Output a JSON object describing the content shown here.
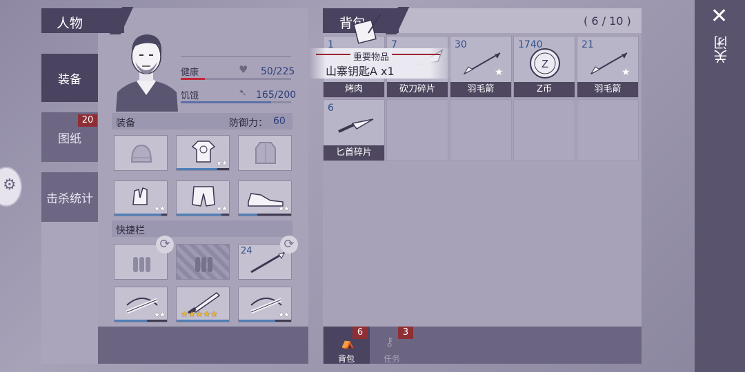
{
  "character": {
    "header": "人物",
    "health_label": "健康",
    "health_value": "50/225",
    "health_fraction": 0.22,
    "hunger_label": "饥饿",
    "hunger_value": "165/200",
    "hunger_fraction": 0.82,
    "equip_label": "装备",
    "defense_label": "防御力：",
    "defense_value": "60",
    "quickbar_label": "快捷栏",
    "quickbar_count": "24"
  },
  "left_tabs": [
    {
      "label": "装备"
    },
    {
      "label": "图纸",
      "badge": "20"
    },
    {
      "label": "击杀统计"
    }
  ],
  "backpack": {
    "header": "背包",
    "capacity": "( 6 / 10 )",
    "tooltip_title": "重要物品",
    "tooltip_item": "山寨钥匙A x1",
    "items": [
      {
        "count": "1",
        "name": "烤肉"
      },
      {
        "count": "7",
        "name": "砍刀碎片"
      },
      {
        "count": "30",
        "name": "羽毛箭"
      },
      {
        "count": "1740",
        "name": "Z币"
      },
      {
        "count": "21",
        "name": "羽毛箭"
      },
      {
        "count": "6",
        "name": "匕首碎片"
      }
    ],
    "tabs": [
      {
        "label": "背包",
        "badge": "6"
      },
      {
        "label": "任务",
        "badge": "3"
      }
    ]
  },
  "close_label": "关闭",
  "colors": {
    "health": "#c0283a",
    "hunger": "#5c6fa8",
    "accent": "#4a4360"
  }
}
